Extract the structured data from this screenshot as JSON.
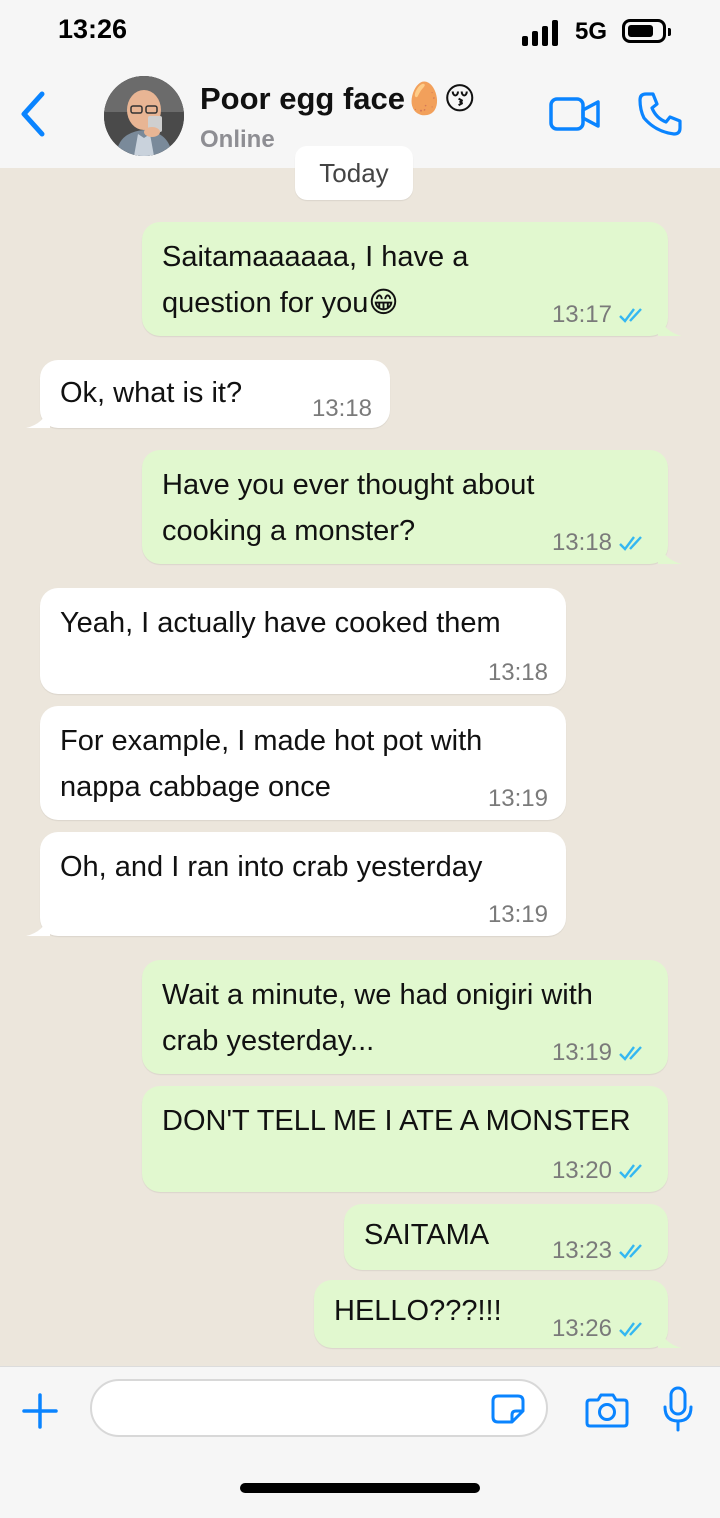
{
  "status_bar": {
    "time": "13:26",
    "network": "5G"
  },
  "header": {
    "contact_name": "Poor egg face🥚😚",
    "contact_status": "Online",
    "icons": [
      "chevron-left-icon",
      "avatar",
      "video-camera-icon",
      "phone-icon"
    ],
    "accent_color": "#0a84ff"
  },
  "chat": {
    "date_label": "Today",
    "messages": [
      {
        "direction": "out",
        "text": "Saitamaaaaaa, I have a question for you😁",
        "time": "13:17",
        "status": "read"
      },
      {
        "direction": "in",
        "text": "Ok, what is it?",
        "time": "13:18"
      },
      {
        "direction": "out",
        "text": "Have you ever thought about cooking a monster?",
        "time": "13:18",
        "status": "read"
      },
      {
        "direction": "in",
        "text": "Yeah, I actually have cooked them",
        "time": "13:18"
      },
      {
        "direction": "in",
        "text": "For example, I made hot pot with nappa cabbage once",
        "time": "13:19"
      },
      {
        "direction": "in",
        "text": "Oh, and I ran into crab yesterday",
        "time": "13:19"
      },
      {
        "direction": "out",
        "text": "Wait a minute, we had onigiri with crab yesterday...",
        "time": "13:19",
        "status": "read"
      },
      {
        "direction": "out",
        "text": "DON'T TELL ME I ATE A MONSTER",
        "time": "13:20",
        "status": "read"
      },
      {
        "direction": "out",
        "text": "SAITAMA",
        "time": "13:23",
        "status": "read"
      },
      {
        "direction": "out",
        "text": "HELLO???!!!",
        "time": "13:26",
        "status": "read"
      }
    ],
    "colors": {
      "outgoing_bubble": "#e1f8cf",
      "incoming_bubble": "#ffffff",
      "read_ticks": "#34b7f1"
    }
  },
  "input_bar": {
    "placeholder": "",
    "icons": [
      "plus-icon",
      "sticker-icon",
      "camera-icon",
      "microphone-icon"
    ]
  }
}
